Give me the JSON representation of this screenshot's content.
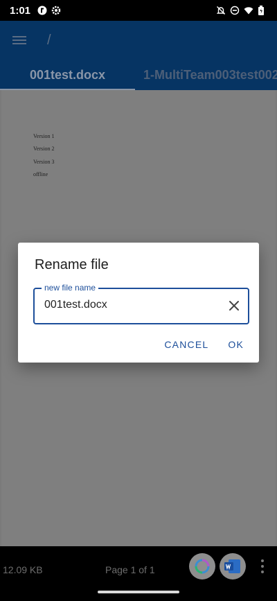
{
  "status_bar": {
    "time": "1:01"
  },
  "app_bar": {
    "path": "/"
  },
  "tabs": [
    {
      "label": "001test.docx",
      "selected": true
    },
    {
      "label": "1-MultiTeam003test002",
      "selected": false
    }
  ],
  "document": {
    "lines": [
      "Version 1",
      "Version 2",
      "Version 3",
      "offline"
    ]
  },
  "dialog": {
    "title": "Rename file",
    "field_label": "new file name",
    "field_value": "001test.docx",
    "cancel_label": "CANCEL",
    "ok_label": "OK"
  },
  "bottom_bar": {
    "file_size": "12.09 KB",
    "page_indicator": "Page 1 of 1"
  },
  "colors": {
    "app_bar": "#063463",
    "accent": "#1c4e9a"
  }
}
